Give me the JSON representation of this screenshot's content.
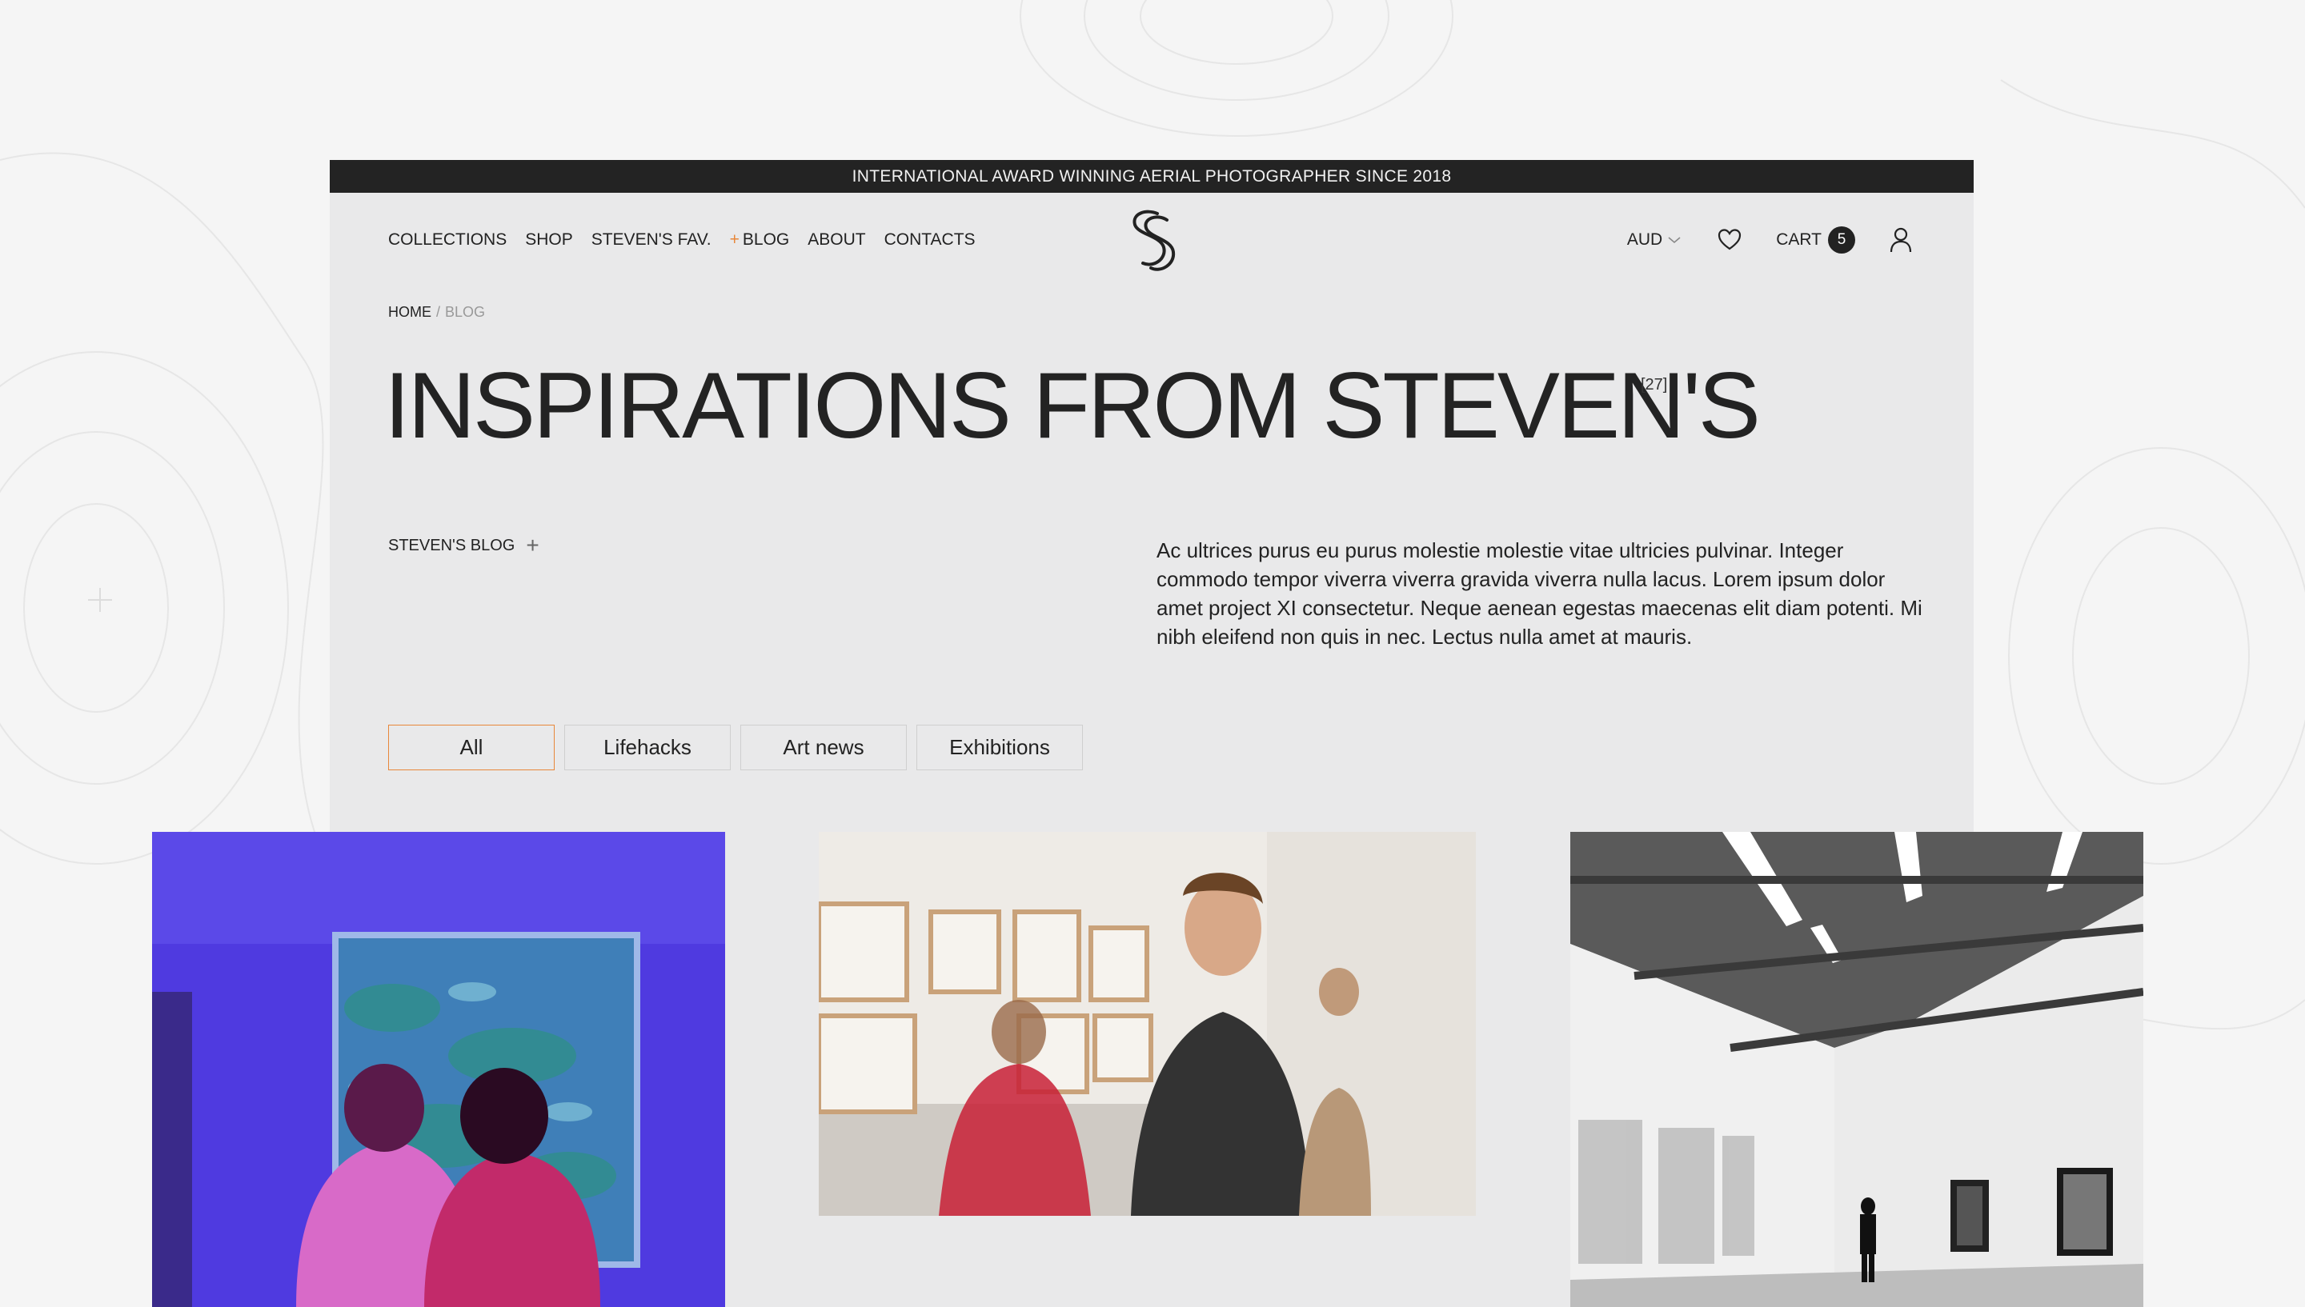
{
  "announcement": "INTERNATIONAL AWARD WINNING AERIAL PHOTOGRAPHER SINCE 2018",
  "nav": {
    "items": [
      {
        "label": "COLLECTIONS"
      },
      {
        "label": "SHOP"
      },
      {
        "label": "STEVEN'S FAV."
      },
      {
        "label": "BLOG",
        "marker": "+"
      },
      {
        "label": "ABOUT"
      },
      {
        "label": "CONTACTS"
      }
    ],
    "currency": "AUD",
    "cart_label": "CART",
    "cart_count": "5",
    "icons": {
      "logo": "ss-monogram-logo",
      "wishlist": "heart-icon",
      "account": "user-icon",
      "currency_dropdown": "chevron-down-icon"
    }
  },
  "breadcrumb": {
    "home": "HOME",
    "separator": "/",
    "current": "BLOG"
  },
  "hero": {
    "title": "INSPIRATIONS FROM STEVEN'S",
    "count": "[27]"
  },
  "blog_section": {
    "label": "STEVEN'S BLOG",
    "toggle": "+"
  },
  "intro_text": "Ac ultrices purus eu purus molestie molestie vitae ultricies pulvinar. Integer commodo tempor viverra viverra gravida viverra nulla lacus. Lorem ipsum dolor amet project XI consectetur. Neque aenean egestas maecenas elit diam potenti. Mi nibh eleifend non quis in nec. Lectus nulla amet at mauris.",
  "filters": [
    {
      "label": "All",
      "active": true
    },
    {
      "label": "Lifehacks",
      "active": false
    },
    {
      "label": "Art news",
      "active": false
    },
    {
      "label": "Exhibitions",
      "active": false
    }
  ],
  "colors": {
    "accent": "#e8873a",
    "dark": "#232323",
    "panel": "#e9e9ea",
    "page_bg": "#f5f5f5"
  }
}
